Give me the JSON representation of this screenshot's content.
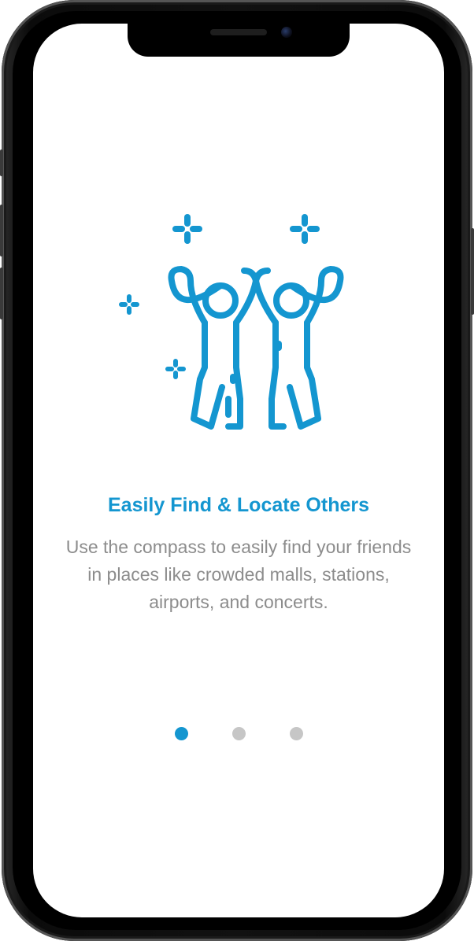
{
  "onboarding": {
    "title": "Easily Find & Locate Others",
    "description": "Use the compass to easily find your friends in places like crowded malls, stations, airports, and concerts.",
    "illustration_icon": "people-celebrating-icon",
    "accent_color": "#1496d0",
    "text_color": "#8c8c8c"
  },
  "pagination": {
    "total_pages": 3,
    "current_page": 1,
    "active_color": "#1496d0",
    "inactive_color": "#c6c6c6"
  }
}
